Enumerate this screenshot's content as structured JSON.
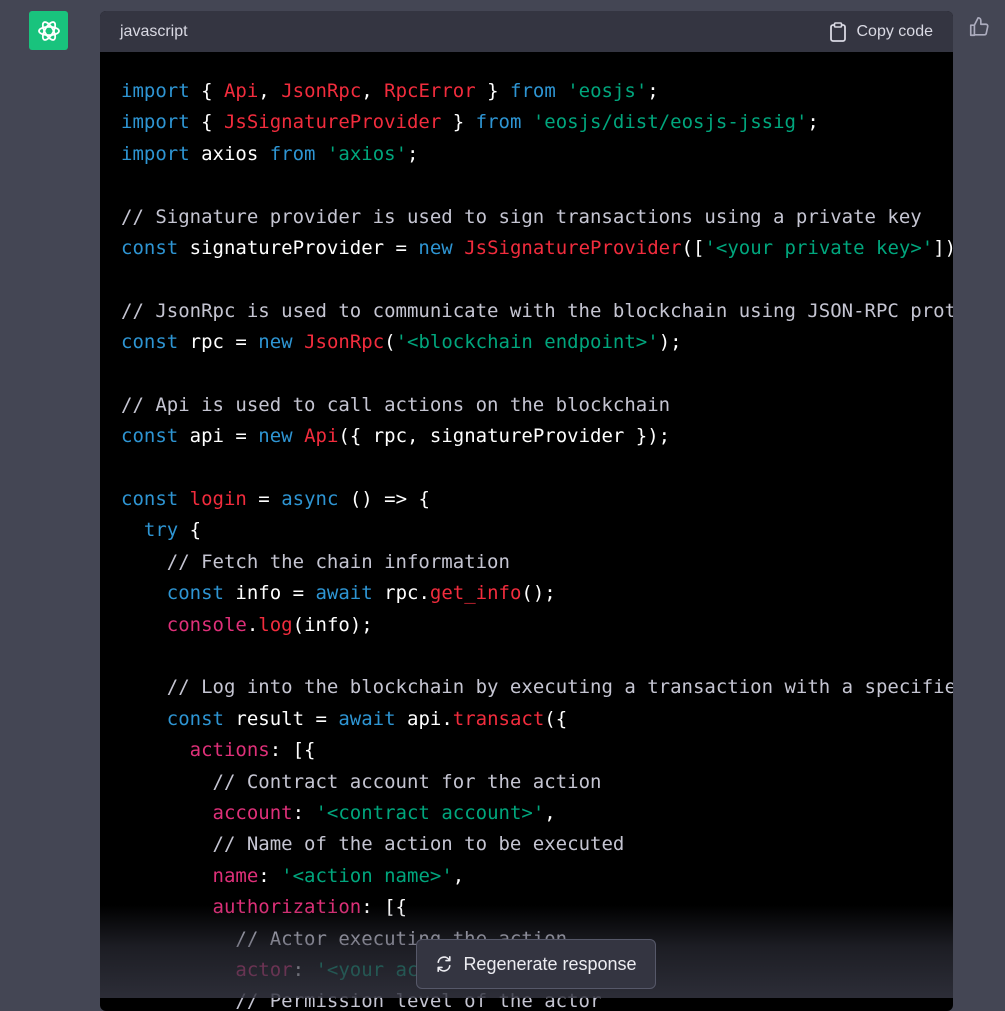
{
  "header": {
    "language": "javascript",
    "copy_label": "Copy code"
  },
  "code": {
    "lines": [
      [
        {
          "t": "import",
          "c": "kw"
        },
        {
          "t": " { "
        },
        {
          "t": "Api",
          "c": "cls"
        },
        {
          "t": ", "
        },
        {
          "t": "JsonRpc",
          "c": "cls"
        },
        {
          "t": ", "
        },
        {
          "t": "RpcError",
          "c": "cls"
        },
        {
          "t": " } "
        },
        {
          "t": "from",
          "c": "kw"
        },
        {
          "t": " "
        },
        {
          "t": "'eosjs'",
          "c": "str"
        },
        {
          "t": ";"
        }
      ],
      [
        {
          "t": "import",
          "c": "kw"
        },
        {
          "t": " { "
        },
        {
          "t": "JsSignatureProvider",
          "c": "cls"
        },
        {
          "t": " } "
        },
        {
          "t": "from",
          "c": "kw"
        },
        {
          "t": " "
        },
        {
          "t": "'eosjs/dist/eosjs-jssig'",
          "c": "str"
        },
        {
          "t": ";"
        }
      ],
      [
        {
          "t": "import",
          "c": "kw"
        },
        {
          "t": " axios "
        },
        {
          "t": "from",
          "c": "kw"
        },
        {
          "t": " "
        },
        {
          "t": "'axios'",
          "c": "str"
        },
        {
          "t": ";"
        }
      ],
      [],
      [
        {
          "t": "// Signature provider is used to sign transactions using a private key",
          "c": "cm"
        }
      ],
      [
        {
          "t": "const",
          "c": "kw"
        },
        {
          "t": " signatureProvider = "
        },
        {
          "t": "new",
          "c": "kw"
        },
        {
          "t": " "
        },
        {
          "t": "JsSignatureProvider",
          "c": "cls"
        },
        {
          "t": "(["
        },
        {
          "t": "'<your private key>'",
          "c": "str"
        },
        {
          "t": "]);"
        }
      ],
      [],
      [
        {
          "t": "// JsonRpc is used to communicate with the blockchain using JSON-RPC protoco",
          "c": "cm"
        }
      ],
      [
        {
          "t": "const",
          "c": "kw"
        },
        {
          "t": " rpc = "
        },
        {
          "t": "new",
          "c": "kw"
        },
        {
          "t": " "
        },
        {
          "t": "JsonRpc",
          "c": "cls"
        },
        {
          "t": "("
        },
        {
          "t": "'<blockchain endpoint>'",
          "c": "str"
        },
        {
          "t": ");"
        }
      ],
      [],
      [
        {
          "t": "// Api is used to call actions on the blockchain",
          "c": "cm"
        }
      ],
      [
        {
          "t": "const",
          "c": "kw"
        },
        {
          "t": " api = "
        },
        {
          "t": "new",
          "c": "kw"
        },
        {
          "t": " "
        },
        {
          "t": "Api",
          "c": "cls"
        },
        {
          "t": "({ rpc, signatureProvider });"
        }
      ],
      [],
      [
        {
          "t": "const",
          "c": "kw"
        },
        {
          "t": " "
        },
        {
          "t": "login",
          "c": "cls"
        },
        {
          "t": " = "
        },
        {
          "t": "async",
          "c": "kw"
        },
        {
          "t": " () => {"
        }
      ],
      [
        {
          "t": "  "
        },
        {
          "t": "try",
          "c": "kw"
        },
        {
          "t": " {"
        }
      ],
      [
        {
          "t": "    "
        },
        {
          "t": "// Fetch the chain information",
          "c": "cm"
        }
      ],
      [
        {
          "t": "    "
        },
        {
          "t": "const",
          "c": "kw"
        },
        {
          "t": " info = "
        },
        {
          "t": "await",
          "c": "kw"
        },
        {
          "t": " rpc."
        },
        {
          "t": "get_info",
          "c": "cls"
        },
        {
          "t": "();"
        }
      ],
      [
        {
          "t": "    "
        },
        {
          "t": "console",
          "c": "prop"
        },
        {
          "t": "."
        },
        {
          "t": "log",
          "c": "cls"
        },
        {
          "t": "(info);"
        }
      ],
      [],
      [
        {
          "t": "    "
        },
        {
          "t": "// Log into the blockchain by executing a transaction with a specified a",
          "c": "cm"
        }
      ],
      [
        {
          "t": "    "
        },
        {
          "t": "const",
          "c": "kw"
        },
        {
          "t": " result = "
        },
        {
          "t": "await",
          "c": "kw"
        },
        {
          "t": " api."
        },
        {
          "t": "transact",
          "c": "cls"
        },
        {
          "t": "({"
        }
      ],
      [
        {
          "t": "      "
        },
        {
          "t": "actions",
          "c": "prop"
        },
        {
          "t": ": [{"
        }
      ],
      [
        {
          "t": "        "
        },
        {
          "t": "// Contract account for the action",
          "c": "cm"
        }
      ],
      [
        {
          "t": "        "
        },
        {
          "t": "account",
          "c": "prop"
        },
        {
          "t": ": "
        },
        {
          "t": "'<contract account>'",
          "c": "str"
        },
        {
          "t": ","
        }
      ],
      [
        {
          "t": "        "
        },
        {
          "t": "// Name of the action to be executed",
          "c": "cm"
        }
      ],
      [
        {
          "t": "        "
        },
        {
          "t": "name",
          "c": "prop"
        },
        {
          "t": ": "
        },
        {
          "t": "'<action name>'",
          "c": "str"
        },
        {
          "t": ","
        }
      ],
      [
        {
          "t": "        "
        },
        {
          "t": "authorization",
          "c": "prop"
        },
        {
          "t": ": [{"
        }
      ],
      [
        {
          "t": "          "
        },
        {
          "t": "// Actor executing the action",
          "c": "cm"
        }
      ],
      [
        {
          "t": "          "
        },
        {
          "t": "actor",
          "c": "prop"
        },
        {
          "t": ": "
        },
        {
          "t": "'<your account>'",
          "c": "str"
        },
        {
          "t": ","
        }
      ],
      [
        {
          "t": "          "
        },
        {
          "t": "// Permission level of the actor",
          "c": "cm"
        }
      ]
    ]
  },
  "colors": {
    "kw": "#2e95d3",
    "cls": "#f22c3d",
    "str": "#00a67d",
    "cm": "#c5c5d2",
    "prop": "#df3079",
    "plain": "#ffffff",
    "accent": "#19c37d"
  },
  "icons": {
    "avatar": "openai-logo-icon",
    "copy": "clipboard-icon",
    "feedback": "thumbs-up-icon",
    "regenerate": "refresh-icon"
  },
  "regenerate": {
    "label": "Regenerate response"
  }
}
